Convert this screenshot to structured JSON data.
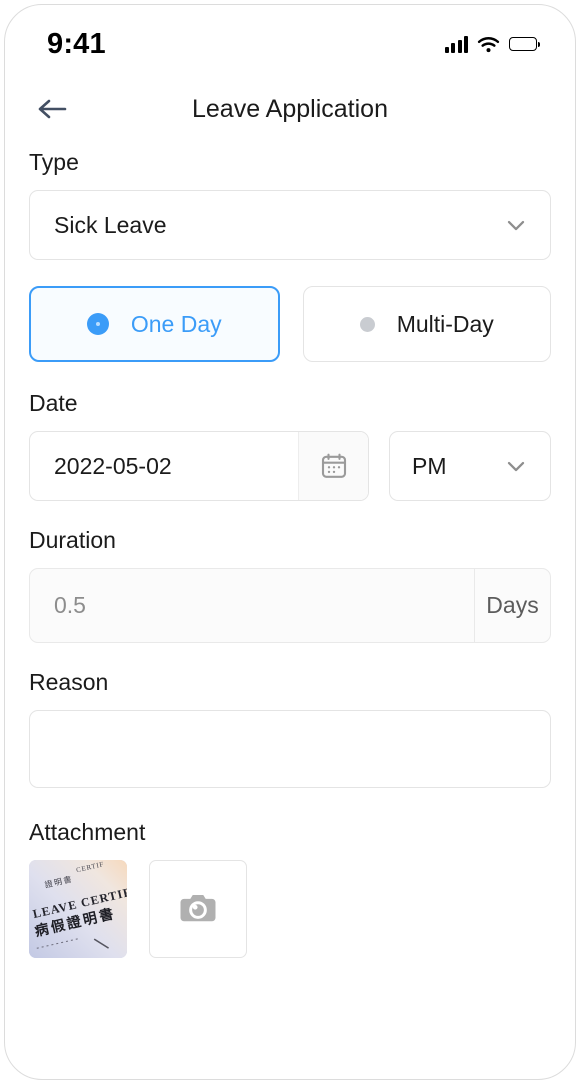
{
  "status_bar": {
    "time": "9:41",
    "signal_icon": "cellular-signal-icon",
    "wifi_icon": "wifi-icon",
    "battery_icon": "battery-full-icon"
  },
  "header": {
    "back_icon": "arrow-left-icon",
    "title": "Leave Application"
  },
  "form": {
    "type": {
      "label": "Type",
      "value": "Sick Leave",
      "chevron_icon": "chevron-down-icon"
    },
    "span_options": [
      {
        "label": "One Day",
        "selected": true
      },
      {
        "label": "Multi-Day",
        "selected": false
      }
    ],
    "date": {
      "label": "Date",
      "value": "2022-05-02",
      "calendar_icon": "calendar-icon",
      "ampm_value": "PM",
      "chevron_icon": "chevron-down-icon"
    },
    "duration": {
      "label": "Duration",
      "value": "0.5",
      "unit": "Days"
    },
    "reason": {
      "label": "Reason",
      "value": "",
      "placeholder": ""
    },
    "attachment": {
      "label": "Attachment",
      "thumbnail_alt": "LEAVE CERTIFICATE",
      "thumbnail_text_en": "LEAVE CERTIFI",
      "thumbnail_text_zh": "病假證明書",
      "add_icon": "camera-icon"
    }
  },
  "colors": {
    "accent": "#3b9cf8",
    "text": "#1b1b1b",
    "muted": "#8d8d8d",
    "border": "#e4e4e4"
  }
}
